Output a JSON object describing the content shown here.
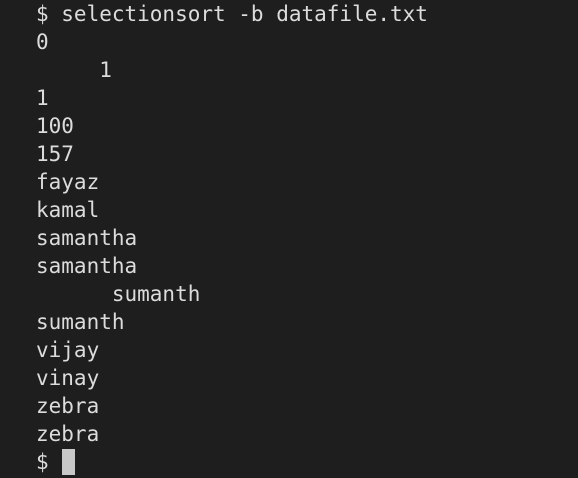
{
  "terminal": {
    "command_line": "$ selectionsort -b datafile.txt",
    "output": [
      "0",
      "     1",
      "1",
      "100",
      "157",
      "fayaz",
      "kamal",
      "samantha",
      "samantha",
      "      sumanth",
      "sumanth",
      "vijay",
      "vinay",
      "zebra",
      "zebra"
    ],
    "prompt": "$",
    "colors": {
      "background": "#1e1e1e",
      "text": "#dcdcdc",
      "cursor": "#c8c8c8"
    }
  }
}
